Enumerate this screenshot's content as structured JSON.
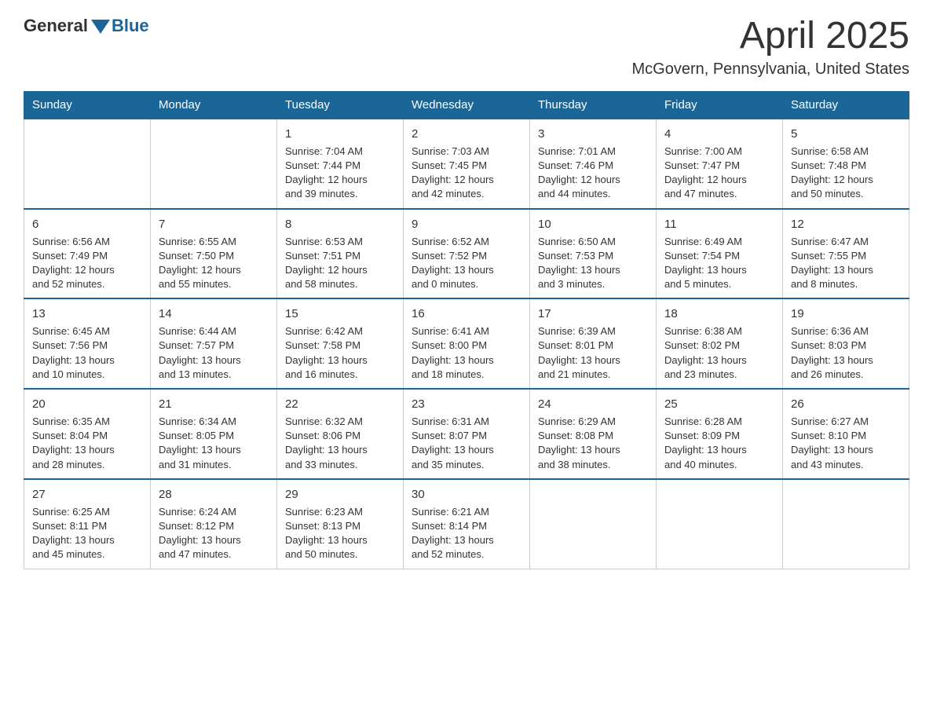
{
  "logo": {
    "general": "General",
    "blue": "Blue"
  },
  "title": "April 2025",
  "location": "McGovern, Pennsylvania, United States",
  "headers": [
    "Sunday",
    "Monday",
    "Tuesday",
    "Wednesday",
    "Thursday",
    "Friday",
    "Saturday"
  ],
  "weeks": [
    [
      {
        "day": "",
        "info": ""
      },
      {
        "day": "",
        "info": ""
      },
      {
        "day": "1",
        "info": "Sunrise: 7:04 AM\nSunset: 7:44 PM\nDaylight: 12 hours\nand 39 minutes."
      },
      {
        "day": "2",
        "info": "Sunrise: 7:03 AM\nSunset: 7:45 PM\nDaylight: 12 hours\nand 42 minutes."
      },
      {
        "day": "3",
        "info": "Sunrise: 7:01 AM\nSunset: 7:46 PM\nDaylight: 12 hours\nand 44 minutes."
      },
      {
        "day": "4",
        "info": "Sunrise: 7:00 AM\nSunset: 7:47 PM\nDaylight: 12 hours\nand 47 minutes."
      },
      {
        "day": "5",
        "info": "Sunrise: 6:58 AM\nSunset: 7:48 PM\nDaylight: 12 hours\nand 50 minutes."
      }
    ],
    [
      {
        "day": "6",
        "info": "Sunrise: 6:56 AM\nSunset: 7:49 PM\nDaylight: 12 hours\nand 52 minutes."
      },
      {
        "day": "7",
        "info": "Sunrise: 6:55 AM\nSunset: 7:50 PM\nDaylight: 12 hours\nand 55 minutes."
      },
      {
        "day": "8",
        "info": "Sunrise: 6:53 AM\nSunset: 7:51 PM\nDaylight: 12 hours\nand 58 minutes."
      },
      {
        "day": "9",
        "info": "Sunrise: 6:52 AM\nSunset: 7:52 PM\nDaylight: 13 hours\nand 0 minutes."
      },
      {
        "day": "10",
        "info": "Sunrise: 6:50 AM\nSunset: 7:53 PM\nDaylight: 13 hours\nand 3 minutes."
      },
      {
        "day": "11",
        "info": "Sunrise: 6:49 AM\nSunset: 7:54 PM\nDaylight: 13 hours\nand 5 minutes."
      },
      {
        "day": "12",
        "info": "Sunrise: 6:47 AM\nSunset: 7:55 PM\nDaylight: 13 hours\nand 8 minutes."
      }
    ],
    [
      {
        "day": "13",
        "info": "Sunrise: 6:45 AM\nSunset: 7:56 PM\nDaylight: 13 hours\nand 10 minutes."
      },
      {
        "day": "14",
        "info": "Sunrise: 6:44 AM\nSunset: 7:57 PM\nDaylight: 13 hours\nand 13 minutes."
      },
      {
        "day": "15",
        "info": "Sunrise: 6:42 AM\nSunset: 7:58 PM\nDaylight: 13 hours\nand 16 minutes."
      },
      {
        "day": "16",
        "info": "Sunrise: 6:41 AM\nSunset: 8:00 PM\nDaylight: 13 hours\nand 18 minutes."
      },
      {
        "day": "17",
        "info": "Sunrise: 6:39 AM\nSunset: 8:01 PM\nDaylight: 13 hours\nand 21 minutes."
      },
      {
        "day": "18",
        "info": "Sunrise: 6:38 AM\nSunset: 8:02 PM\nDaylight: 13 hours\nand 23 minutes."
      },
      {
        "day": "19",
        "info": "Sunrise: 6:36 AM\nSunset: 8:03 PM\nDaylight: 13 hours\nand 26 minutes."
      }
    ],
    [
      {
        "day": "20",
        "info": "Sunrise: 6:35 AM\nSunset: 8:04 PM\nDaylight: 13 hours\nand 28 minutes."
      },
      {
        "day": "21",
        "info": "Sunrise: 6:34 AM\nSunset: 8:05 PM\nDaylight: 13 hours\nand 31 minutes."
      },
      {
        "day": "22",
        "info": "Sunrise: 6:32 AM\nSunset: 8:06 PM\nDaylight: 13 hours\nand 33 minutes."
      },
      {
        "day": "23",
        "info": "Sunrise: 6:31 AM\nSunset: 8:07 PM\nDaylight: 13 hours\nand 35 minutes."
      },
      {
        "day": "24",
        "info": "Sunrise: 6:29 AM\nSunset: 8:08 PM\nDaylight: 13 hours\nand 38 minutes."
      },
      {
        "day": "25",
        "info": "Sunrise: 6:28 AM\nSunset: 8:09 PM\nDaylight: 13 hours\nand 40 minutes."
      },
      {
        "day": "26",
        "info": "Sunrise: 6:27 AM\nSunset: 8:10 PM\nDaylight: 13 hours\nand 43 minutes."
      }
    ],
    [
      {
        "day": "27",
        "info": "Sunrise: 6:25 AM\nSunset: 8:11 PM\nDaylight: 13 hours\nand 45 minutes."
      },
      {
        "day": "28",
        "info": "Sunrise: 6:24 AM\nSunset: 8:12 PM\nDaylight: 13 hours\nand 47 minutes."
      },
      {
        "day": "29",
        "info": "Sunrise: 6:23 AM\nSunset: 8:13 PM\nDaylight: 13 hours\nand 50 minutes."
      },
      {
        "day": "30",
        "info": "Sunrise: 6:21 AM\nSunset: 8:14 PM\nDaylight: 13 hours\nand 52 minutes."
      },
      {
        "day": "",
        "info": ""
      },
      {
        "day": "",
        "info": ""
      },
      {
        "day": "",
        "info": ""
      }
    ]
  ]
}
